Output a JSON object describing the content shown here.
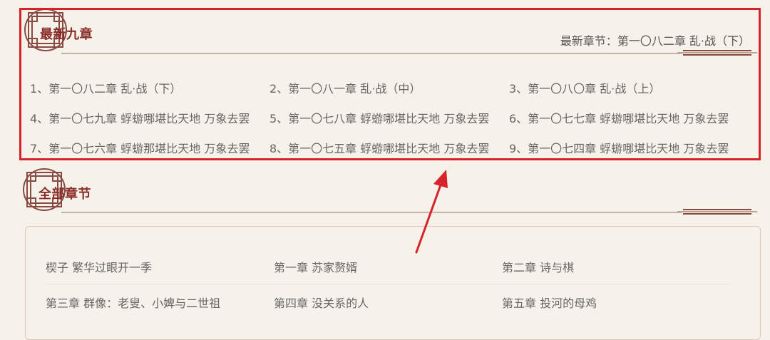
{
  "latest_section": {
    "title": "最新九章",
    "latest_prefix": "最新章节：",
    "latest_link": "第一〇八二章 乱·战（下）",
    "chapters": [
      [
        "1、第一〇八二章 乱·战（下）",
        "2、第一〇八一章 乱·战（中）",
        "3、第一〇八〇章 乱·战（上）"
      ],
      [
        "4、第一〇七九章 蜉蝣哪堪比天地 万象去罢",
        "5、第一〇七八章 蜉蝣哪堪比天地 万象去罢",
        "6、第一〇七七章 蜉蝣哪堪比天地 万象去罢"
      ],
      [
        "7、第一〇七六章 蜉蝣那堪比天地 万象去罢",
        "8、第一〇七五章 蜉蝣哪堪比天地 万象去罢",
        "9、第一〇七四章 蜉蝣哪堪比天地 万象去罢"
      ]
    ]
  },
  "all_section": {
    "title": "全部章节",
    "chapters": [
      [
        "楔子 繁华过眼开一季",
        "第一章 苏家赘婿",
        "第二章 诗与棋"
      ],
      [
        "第三章 群像：老叟、小婢与二世祖",
        "第四章 没关系的人",
        "第五章 投河的母鸡"
      ]
    ]
  },
  "colors": {
    "highlight": "#d8232a",
    "title": "#8a2e2a",
    "badge": "#8a4a44",
    "background": "#f6f2ea"
  }
}
